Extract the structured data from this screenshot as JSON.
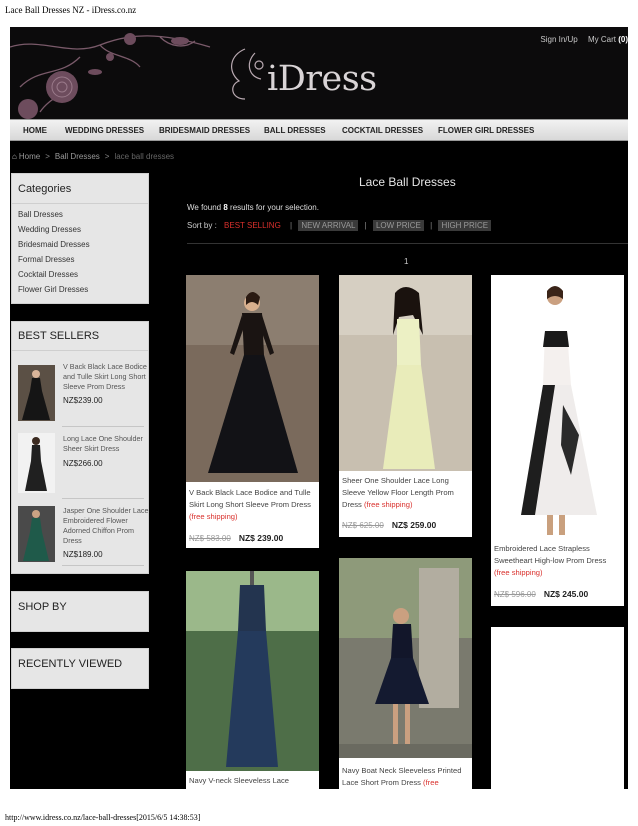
{
  "print": {
    "title": "Lace Ball Dresses NZ - iDress.co.nz",
    "footer": "http://www.idress.co.nz/lace-ball-dresses[2015/6/5 14:38:53]"
  },
  "header": {
    "logo": "iDress",
    "sign_in": "Sign In/Up",
    "cart_label": "My Cart",
    "cart_count": "(0)"
  },
  "nav": [
    "HOME",
    "WEDDING DRESSES",
    "BRIDESMAID DRESSES",
    "BALL DRESSES",
    "COCKTAIL DRESSES",
    "FLOWER GIRL DRESSES"
  ],
  "breadcrumb": {
    "home": "Home",
    "sep": ">",
    "parent": "Ball Dresses",
    "current": "lace ball dresses"
  },
  "sidebar": {
    "categories_title": "Categories",
    "categories": [
      "Ball Dresses",
      "Wedding Dresses",
      "Bridesmaid Dresses",
      "Formal Dresses",
      "Cocktail Dresses",
      "Flower Girl Dresses"
    ],
    "best_title": "BEST SELLERS",
    "best": [
      {
        "name": "V Back Black Lace Bodice and Tulle Skirt Long Short Sleeve Prom Dress",
        "price": "NZ$239.00"
      },
      {
        "name": "Long Lace One Shoulder Sheer Skirt Dress",
        "price": "NZ$266.00"
      },
      {
        "name": "Jasper One Shoulder Lace Embroidered Flower Adorned Chiffon Prom Dress",
        "price": "NZ$189.00"
      }
    ],
    "shop_by": "SHOP BY",
    "recent": "RECENTLY VIEWED"
  },
  "content": {
    "title": "Lace Ball Dresses",
    "found_prefix": "We found",
    "found_count": "8",
    "found_suffix": "results for your selection.",
    "sort_label": "Sort by :",
    "sort": [
      "BEST SELLING",
      "NEW ARRIVAL",
      "LOW PRICE",
      "HIGH PRICE"
    ],
    "sort_sep": "|",
    "page": "1"
  },
  "products": [
    {
      "name": "V Back Black Lace Bodice and Tulle Skirt Long Short Sleeve Prom Dress",
      "shipping": "(free shipping)",
      "old_price": "NZ$ 583.00",
      "price": "NZ$ 239.00"
    },
    {
      "name": "Sheer One Shoulder Lace Long Sleeve Yellow Floor Length Prom Dress",
      "shipping": "(free shipping)",
      "old_price": "NZ$ 625.00",
      "price": "NZ$ 259.00"
    },
    {
      "name": "Embroidered Lace Strapless Sweetheart High-low Prom Dress",
      "shipping": "(free shipping)",
      "old_price": "NZ$ 596.00",
      "price": "NZ$ 245.00"
    },
    {
      "name": "Navy V-neck Sleeveless Lace",
      "shipping": "",
      "old_price": "",
      "price": ""
    },
    {
      "name": "Navy Boat Neck Sleeveless Printed Lace Short Prom Dress",
      "shipping": "(free shipping)",
      "old_price": "",
      "price": ""
    }
  ]
}
